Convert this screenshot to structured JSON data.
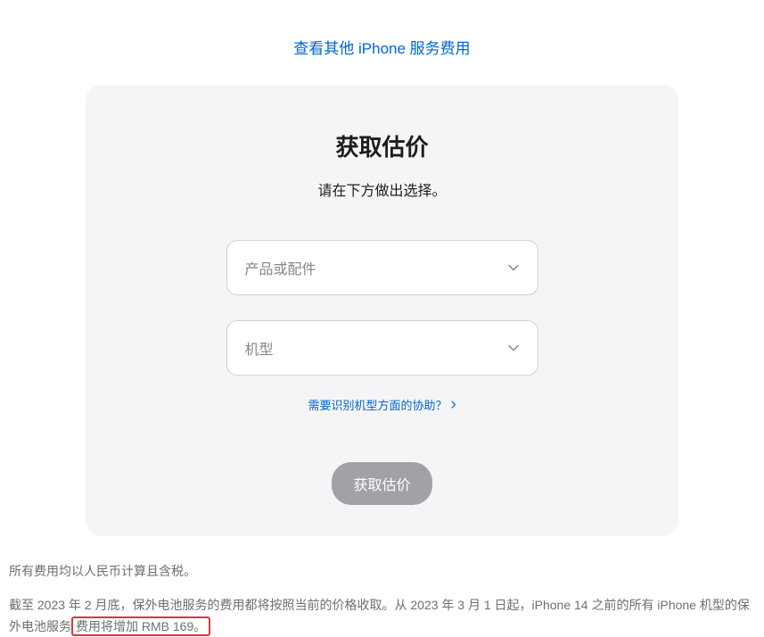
{
  "topLink": {
    "label": "查看其他 iPhone 服务费用"
  },
  "card": {
    "title": "获取估价",
    "subtitle": "请在下方做出选择。",
    "select1": {
      "placeholder": "产品或配件"
    },
    "select2": {
      "placeholder": "机型"
    },
    "helpLink": "需要识别机型方面的协助？",
    "submitLabel": "获取估价"
  },
  "footer": {
    "line1": "所有费用均以人民币计算且含税。",
    "line2a": "截至 2023 年 2 月底，保外电池服务的费用都将按照当前的价格收取。从 2023 年 3 月 1 日起，iPhone 14 之前的所有 iPhone 机型的保外电池服务",
    "line2b": "费用将增加 RMB 169。"
  }
}
